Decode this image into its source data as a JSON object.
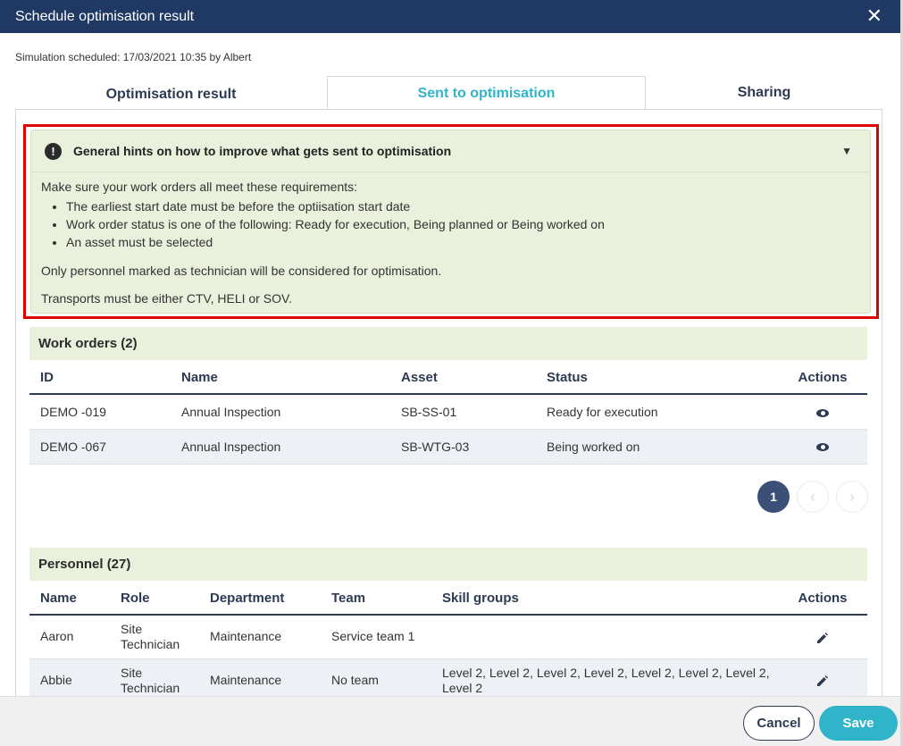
{
  "window": {
    "title": "Schedule optimisation result"
  },
  "simulation_info": "Simulation scheduled: 17/03/2021 10:35 by Albert",
  "tabs": [
    {
      "label": "Optimisation result"
    },
    {
      "label": "Sent to optimisation"
    },
    {
      "label": "Sharing"
    }
  ],
  "hints": {
    "title": "General hints on how to improve what gets sent to optimisation",
    "intro": "Make sure your work orders all meet these requirements:",
    "requirements": [
      "The earliest start date must be before the optiisation start date",
      "Work order status is one of the following: Ready for execution, Being planned or Being worked on",
      "An asset must be selected"
    ],
    "personnel_note": "Only personnel marked as technician will be considered for optimisation.",
    "transport_note": "Transports must be either CTV, HELI or SOV."
  },
  "work_orders": {
    "title": "Work orders (2)",
    "columns": [
      "ID",
      "Name",
      "Asset",
      "Status",
      "Actions"
    ],
    "rows": [
      {
        "id": "DEMO -019",
        "name": "Annual Inspection",
        "asset": "SB-SS-01",
        "status": "Ready for execution"
      },
      {
        "id": "DEMO -067",
        "name": "Annual Inspection",
        "asset": "SB-WTG-03",
        "status": "Being worked on"
      }
    ],
    "pager": {
      "current_page": "1",
      "prev": "‹",
      "next": "›"
    }
  },
  "personnel": {
    "title": "Personnel (27)",
    "columns": [
      "Name",
      "Role",
      "Department",
      "Team",
      "Skill groups",
      "Actions"
    ],
    "rows": [
      {
        "name": "Aaron",
        "role": "Site Technician",
        "department": "Maintenance",
        "team": "Service team 1",
        "skills": ""
      },
      {
        "name": "Abbie",
        "role": "Site Technician",
        "department": "Maintenance",
        "team": "No team",
        "skills": "Level 2, Level 2, Level 2, Level 2, Level 2, Level 2, Level 2, Level 2"
      }
    ]
  },
  "footer": {
    "cancel_label": "Cancel",
    "save_label": "Save"
  },
  "colors": {
    "header": "#1f3864",
    "accent": "#30b4c9",
    "highlight_border": "#e00000",
    "hint_bg": "#e9f1dc"
  }
}
